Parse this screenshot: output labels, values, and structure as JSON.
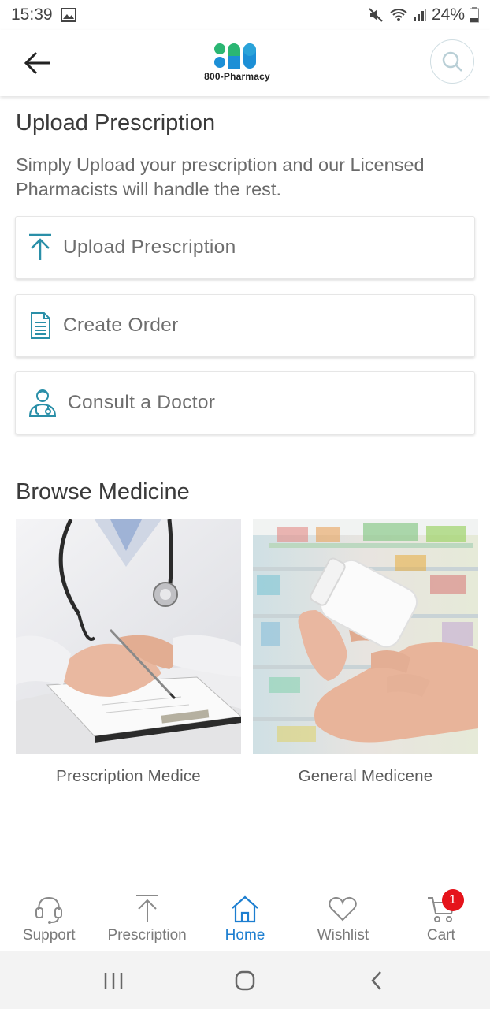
{
  "status_bar": {
    "time": "15:39",
    "battery": "24%"
  },
  "header": {
    "logo_text": "800-Pharmacy",
    "logo_colors": [
      "#2bb673",
      "#1c8fd6"
    ]
  },
  "main": {
    "title": "Upload Prescription",
    "subtitle": "Simply Upload your prescription and our Licensed Pharmacists will handle the rest.",
    "actions": [
      {
        "label": "Upload Prescription",
        "icon": "upload-icon"
      },
      {
        "label": "Create Order",
        "icon": "document-icon"
      },
      {
        "label": "Consult a Doctor",
        "icon": "doctor-icon"
      }
    ],
    "browse_title": "Browse Medicine",
    "tiles": [
      {
        "caption": "Prescription Medice",
        "image": "doctor-writing-prescription"
      },
      {
        "caption": "General Medicene",
        "image": "hand-holding-pill-bottle"
      }
    ]
  },
  "bottom_nav": {
    "items": [
      {
        "label": "Support",
        "icon": "headset-icon",
        "active": false
      },
      {
        "label": "Prescription",
        "icon": "upload-icon",
        "active": false
      },
      {
        "label": "Home",
        "icon": "home-icon",
        "active": true
      },
      {
        "label": "Wishlist",
        "icon": "heart-icon",
        "active": false
      },
      {
        "label": "Cart",
        "icon": "cart-icon",
        "active": false
      }
    ],
    "cart_count": "1"
  },
  "theme": {
    "accent": "#1c7ed0",
    "icon_teal": "#2a8fa8",
    "badge": "#e5131b"
  }
}
